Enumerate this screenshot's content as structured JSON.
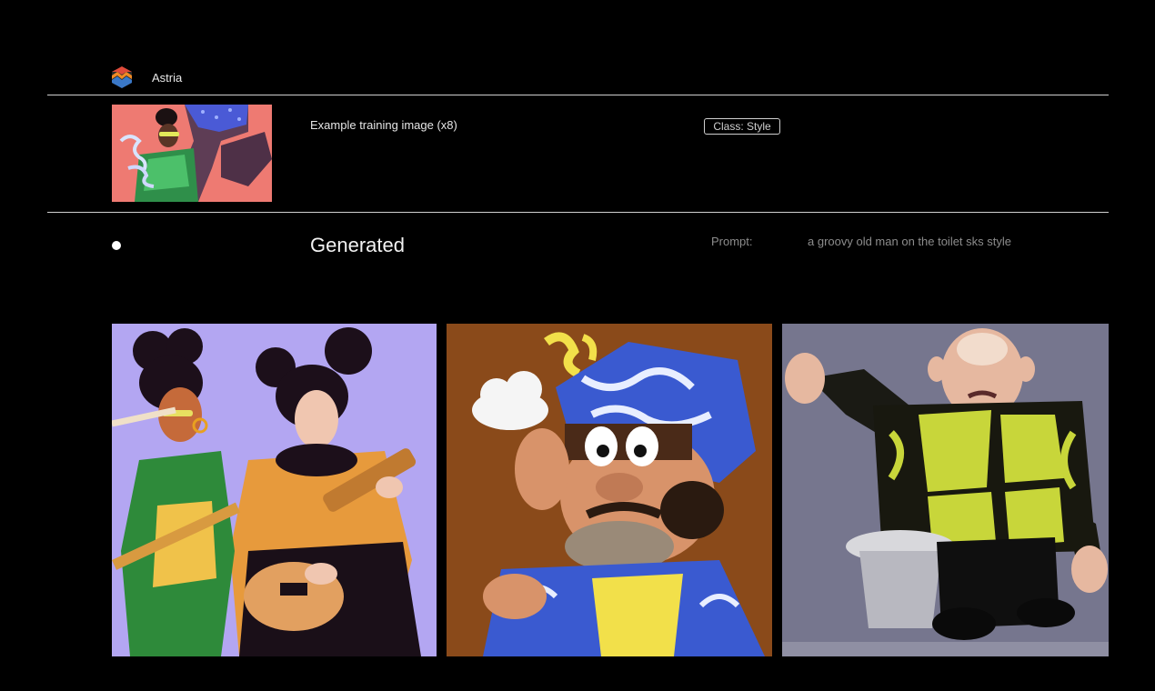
{
  "header": {
    "brand": "Astria",
    "logo_icon": "astria-logo-icon"
  },
  "training": {
    "label": "Example training image (x8)",
    "class_badge": "Class: Style",
    "thumbnail_icon": "training-image"
  },
  "generated": {
    "title": "Generated",
    "prompt_label": "Prompt:",
    "prompt_text": "a groovy old man on the toilet sks style",
    "images": [
      {
        "name": "generated-image-musicians"
      },
      {
        "name": "generated-image-cartoon-man"
      },
      {
        "name": "generated-image-man-on-toilet"
      }
    ]
  },
  "colors": {
    "background": "#000000",
    "rule": "#cfcfcf",
    "muted_text": "#8c8c8c"
  }
}
